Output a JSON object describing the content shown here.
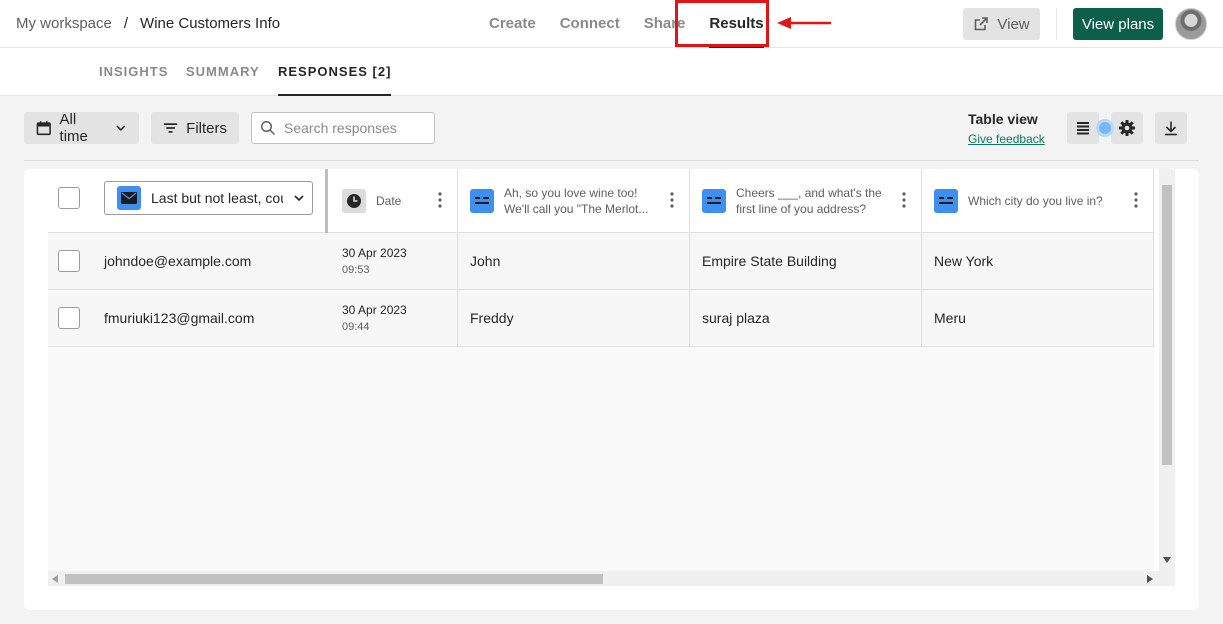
{
  "breadcrumb": {
    "workspace": "My workspace",
    "separator": "/",
    "form": "Wine Customers Info"
  },
  "nav": {
    "create": "Create",
    "connect": "Connect",
    "share": "Share",
    "results": "Results"
  },
  "header_actions": {
    "view": "View",
    "view_plans": "View plans"
  },
  "tabs": {
    "insights": "INSIGHTS",
    "summary": "SUMMARY",
    "responses": "RESPONSES [2]"
  },
  "toolbar": {
    "time_filter": "All time",
    "filters": "Filters",
    "search_placeholder": "Search responses",
    "table_view_label": "Table view",
    "feedback_link": "Give feedback"
  },
  "table": {
    "field_select": "Last but not least, could you share your email?",
    "columns": [
      {
        "label": "Date",
        "icon": "clock-icon"
      },
      {
        "label": "Ah, so you love wine too! We'll call you \"The Merlot...",
        "icon": "short-text-icon"
      },
      {
        "label": "Cheers ___, and what's the first line of you address?",
        "icon": "short-text-icon"
      },
      {
        "label": "Which city do you live in?",
        "icon": "short-text-icon"
      }
    ],
    "rows": [
      {
        "email": "johndoe@example.com",
        "date": "30 Apr 2023",
        "time": "09:53",
        "name": "John",
        "address": "Empire State Building",
        "city": "New York"
      },
      {
        "email": "fmuriuki123@gmail.com",
        "date": "30 Apr 2023",
        "time": "09:44",
        "name": "Freddy",
        "address": "suraj plaza",
        "city": "Meru"
      }
    ]
  },
  "colors": {
    "accent_green": "#0b5f4b",
    "highlight_red": "#e01515",
    "question_blue": "#3d8ff0"
  }
}
